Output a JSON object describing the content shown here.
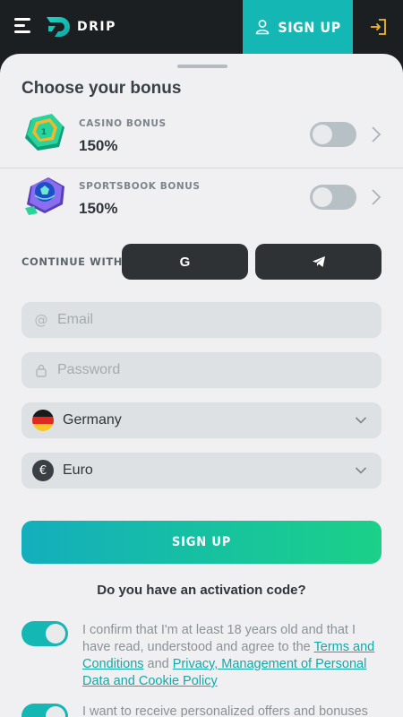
{
  "header": {
    "logo_text": "DRIP",
    "signup_label": "SIGN UP"
  },
  "sheet": {
    "title": "Choose your bonus"
  },
  "bonuses": [
    {
      "title": "CASINO BONUS",
      "value": "150%",
      "enabled": false
    },
    {
      "title": "SPORTSBOOK BONUS",
      "value": "150%",
      "enabled": false
    }
  ],
  "social": {
    "label": "CONTINUE WITH",
    "google_letter": "G"
  },
  "form": {
    "email_placeholder": "Email",
    "password_placeholder": "Password",
    "country": "Germany",
    "currency": "Euro",
    "currency_symbol": "€",
    "submit_label": "SIGN UP",
    "activation_text": "Do you have an activation code?"
  },
  "consents": {
    "age": {
      "enabled": true,
      "prefix": "I confirm that I'm at least 18 years old and that I have read, understood and agree to the ",
      "terms_link": "Terms and Conditions",
      "middle": " and ",
      "privacy_link": "Privacy, Management of Personal Data and Cookie Policy"
    },
    "offers": {
      "enabled": true,
      "text": "I want to receive personalized offers and bonuses"
    }
  },
  "colors": {
    "accent": "#15b7b4",
    "dark": "#1c1f21",
    "sheet_bg": "#f0f0f2"
  }
}
